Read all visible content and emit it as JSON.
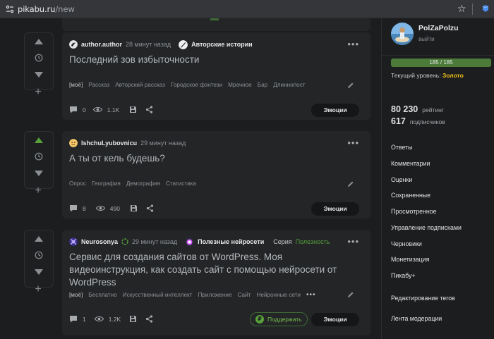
{
  "browser": {
    "url_domain": "pikabu.ru",
    "url_path": "/new",
    "star_icon": "bookmark-star-icon"
  },
  "colors": {
    "accent_green": "#58a13b",
    "gold": "#f2c21b",
    "card_bg": "#232527",
    "page_bg": "#1b1d1f"
  },
  "posts": [
    {
      "author": "author.author",
      "time": "28 минут назад",
      "community": "Авторские истории",
      "title": "Последний зов избыточности",
      "tags": [
        "[моё]",
        "Рассказ",
        "Авторский рассказ",
        "Городское фэнтези",
        "Мрачное",
        "Бар",
        "Длиннопост"
      ],
      "comments": "0",
      "views": "1.1K",
      "emotions_label": "Эмоции",
      "voted_up": false
    },
    {
      "author": "IshchuLyubovnicu",
      "time": "29 минут назад",
      "title": "А ты от кель будешь?",
      "tags": [
        "Опрос",
        "География",
        "Демография",
        "Статистика"
      ],
      "comments": "8",
      "views": "490",
      "emotions_label": "Эмоции",
      "voted_up": true
    },
    {
      "author": "Neurosonya",
      "time": "29 минут назад",
      "community": "Полезные нейросети",
      "series_label": "Серия",
      "series_name": "Полезность",
      "title": "Сервис для создания сайтов от WordPress. Моя видеоинструкция, как создать сайт с помощью нейросети от WordPress",
      "tags": [
        "[моё]",
        "Бесплатно",
        "Искусственный интеллект",
        "Приложение",
        "Сайт",
        "Нейронные сети"
      ],
      "tags_more": "•••",
      "comments": "1",
      "views": "1.2K",
      "support_label": "Поддержать",
      "emotions_label": "Эмоции",
      "voted_up": false
    }
  ],
  "profile": {
    "username": "PolZaPolzu",
    "logout": "выйти",
    "level_progress": "185 / 185",
    "level_fraction": 1.0,
    "level_prefix": "Текущий уровень:",
    "level_name": "Золото",
    "rating": "80 230",
    "rating_label": "рейтинг",
    "subscribers": "617",
    "subscribers_label": "подписчиков"
  },
  "sidebar_nav": [
    "Ответы",
    "Комментарии",
    "Оценки",
    "Сохраненные",
    "Просмотренное",
    "Управление подписками",
    "Черновики",
    "Монетизация",
    "Пикабу+",
    "Редактирование тегов",
    "Лента модерации"
  ]
}
